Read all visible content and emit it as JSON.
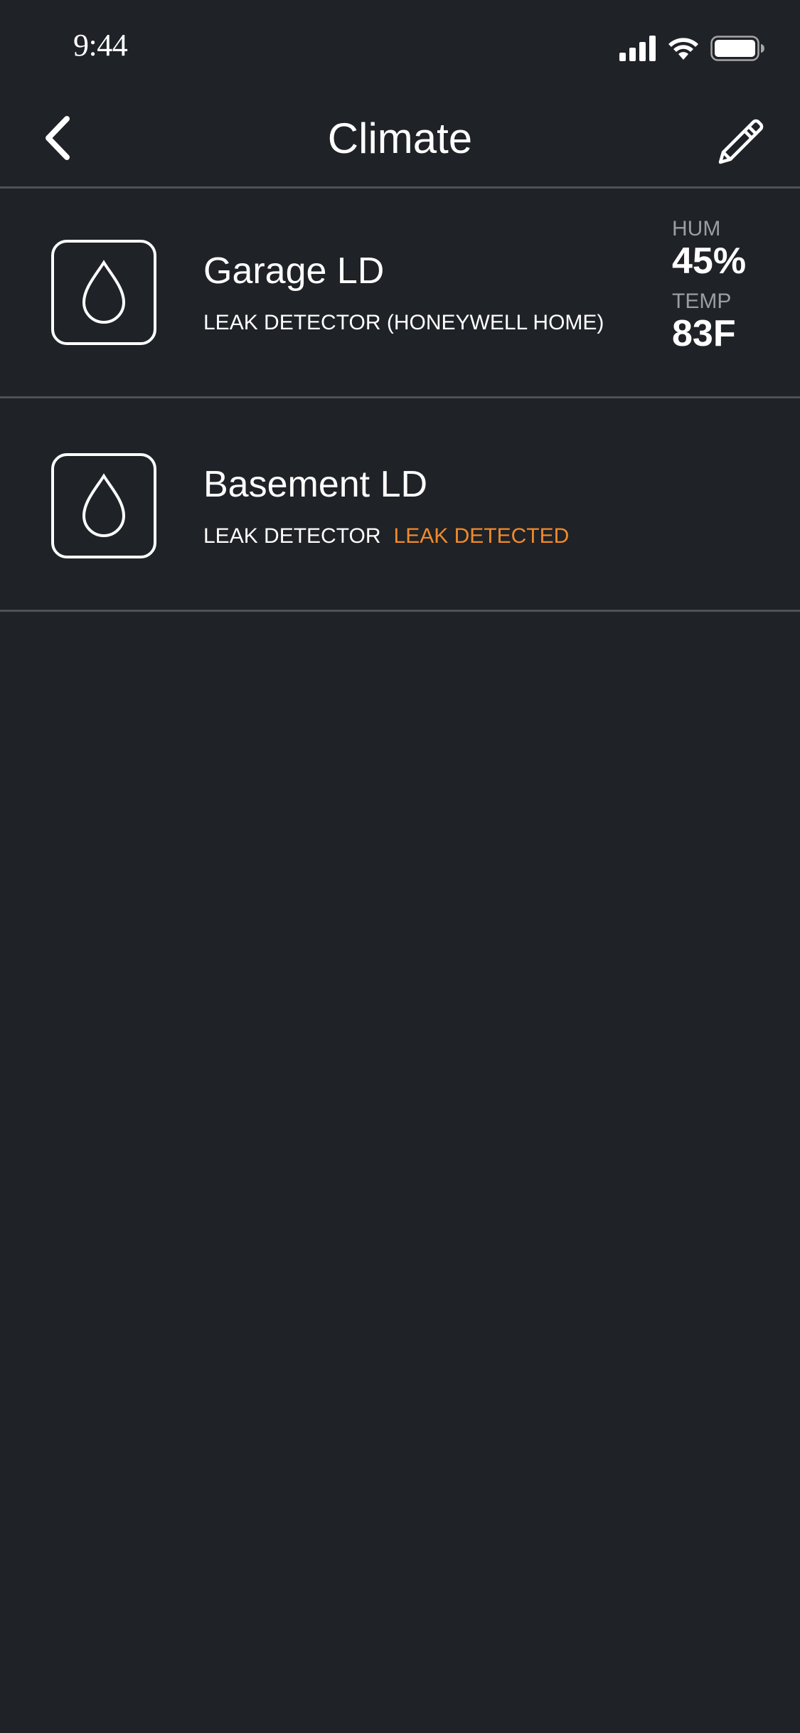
{
  "status_bar": {
    "time": "9:44"
  },
  "nav": {
    "title": "Climate",
    "back_icon": "chevron-left-icon",
    "edit_icon": "pencil-icon"
  },
  "devices": [
    {
      "name": "Garage LD",
      "type": "LEAK DETECTOR (HONEYWELL HOME)",
      "icon": "water-drop-icon",
      "readings": [
        {
          "label": "HUM",
          "value": "45%"
        },
        {
          "label": "TEMP",
          "value": "83F"
        }
      ]
    },
    {
      "name": "Basement LD",
      "type": "LEAK DETECTOR",
      "status": "LEAK DETECTED",
      "icon": "water-drop-icon"
    }
  ],
  "colors": {
    "background": "#1f2226",
    "divider": "#4e5258",
    "alert": "#f08a2c",
    "label_gray": "#9a9ea4"
  }
}
